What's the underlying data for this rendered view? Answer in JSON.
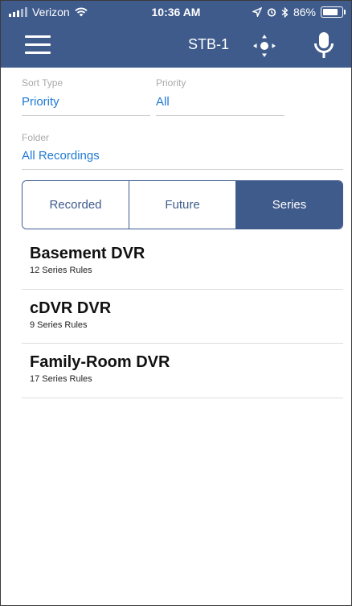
{
  "status_bar": {
    "carrier": "Verizon",
    "time": "10:36 AM",
    "battery": "86%"
  },
  "nav": {
    "device": "STB-1"
  },
  "filters": {
    "sort_type": {
      "label": "Sort Type",
      "value": "Priority"
    },
    "priority": {
      "label": "Priority",
      "value": "All"
    },
    "folder": {
      "label": "Folder",
      "value": "All Recordings"
    }
  },
  "tabs": [
    {
      "label": "Recorded",
      "active": false
    },
    {
      "label": "Future",
      "active": false
    },
    {
      "label": "Series",
      "active": true
    }
  ],
  "dvrs": [
    {
      "name": "Basement DVR",
      "rules": "12 Series Rules"
    },
    {
      "name": "cDVR DVR",
      "rules": "9 Series Rules"
    },
    {
      "name": "Family-Room DVR",
      "rules": "17 Series Rules"
    }
  ],
  "colors": {
    "header": "#3f5b8c",
    "link": "#1e7ad6"
  },
  "icons": [
    "wifi-icon",
    "location-arrow-icon",
    "alarm-icon",
    "bluetooth-icon",
    "battery-icon",
    "menu-icon",
    "dpad-icon",
    "microphone-icon"
  ]
}
